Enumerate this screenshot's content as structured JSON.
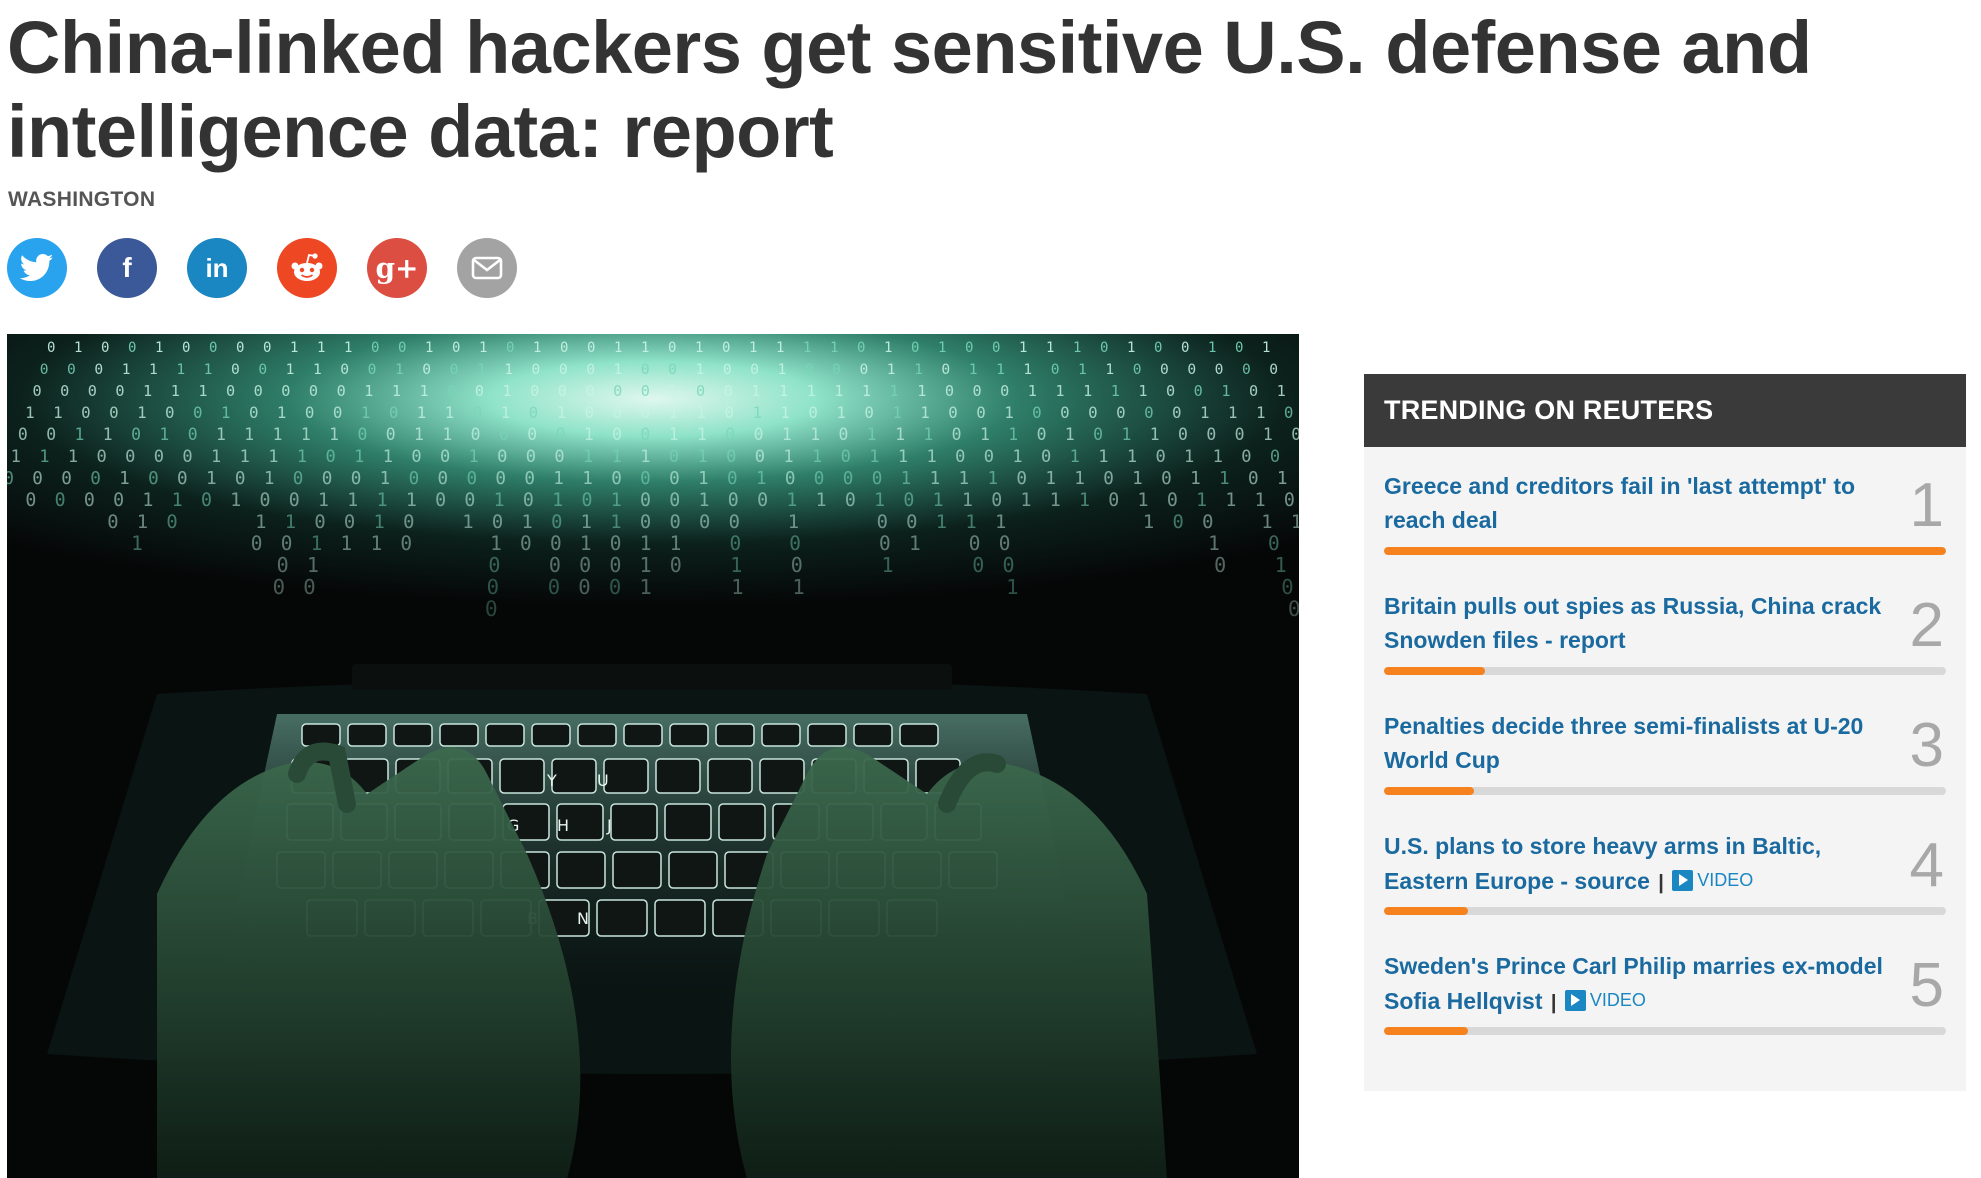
{
  "article": {
    "headline": "China-linked hackers get sensitive U.S. defense and intelligence data: report",
    "dateline": "WASHINGTON"
  },
  "share": [
    {
      "name": "twitter",
      "icon": "twitter-bird-icon",
      "color": "#2aa3ef"
    },
    {
      "name": "facebook",
      "icon": "facebook-f-icon",
      "color": "#3b5998",
      "glyph": "f"
    },
    {
      "name": "linkedin",
      "icon": "linkedin-in-icon",
      "color": "#1a86c2",
      "glyph": "in"
    },
    {
      "name": "reddit",
      "icon": "reddit-alien-icon",
      "color": "#ee4723"
    },
    {
      "name": "google-plus",
      "icon": "google-plus-icon",
      "color": "#dc4e41",
      "glyph": "g+"
    },
    {
      "name": "email",
      "icon": "envelope-icon",
      "color": "#a3a3a3"
    }
  ],
  "hero": {
    "description": "photo-hands-typing-on-laptop-with-binary-code",
    "keycaps": [
      "Y",
      "U",
      "G",
      "H",
      "J",
      "B",
      "N"
    ]
  },
  "trending": {
    "header": "TRENDING ON REUTERS",
    "accent_color": "#f5821f",
    "link_color": "#1a6aa0",
    "items": [
      {
        "rank": "1",
        "title": "Greece and creditors fail in 'last attempt' to reach deal",
        "popularity": 1.0,
        "video": false
      },
      {
        "rank": "2",
        "title": "Britain pulls out spies as Russia, China crack Snowden files - report",
        "popularity": 0.18,
        "video": false
      },
      {
        "rank": "3",
        "title": "Penalties decide three semi-finalists at U-20 World Cup",
        "popularity": 0.16,
        "video": false
      },
      {
        "rank": "4",
        "title": "U.S. plans to store heavy arms in Baltic, Eastern Europe - source",
        "popularity": 0.15,
        "video": true
      },
      {
        "rank": "5",
        "title": "Sweden's Prince Carl Philip marries ex-model Sofia Hellqvist",
        "popularity": 0.15,
        "video": true
      }
    ],
    "separator": "|",
    "video_label": "VIDEO"
  }
}
